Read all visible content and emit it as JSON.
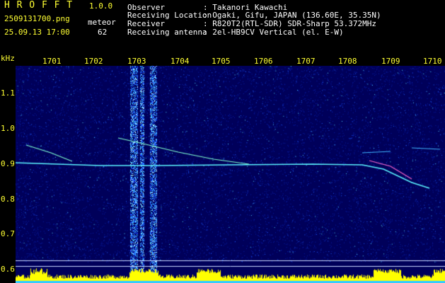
{
  "header": {
    "app_name": "H R O F F T",
    "version": "1.0.0",
    "filename": "2509131700.png",
    "datetime": "25.09.13 17:00",
    "counter_label": "meteor",
    "counter_value": "62",
    "info": [
      {
        "label": "Observer",
        "value": ": Takanori Kawachi"
      },
      {
        "label": "Receiving Location",
        "value": ": Ogaki, Gifu, JAPAN (136.60E, 35.35N)"
      },
      {
        "label": "Receiver",
        "value": ": R820T2(RTL-SDR) SDR-Sharp 53.372MHz"
      },
      {
        "label": "Receiving antenna",
        "value": ": 2el-HB9CV Vertical (el. E-W)"
      }
    ]
  },
  "axes": {
    "y_unit": "kHz",
    "x_ticks": [
      "1701",
      "1702",
      "1703",
      "1704",
      "1705",
      "1706",
      "1707",
      "1708",
      "1709",
      "1710"
    ],
    "y_ticks": [
      "1.1",
      "1.0",
      "0.9",
      "0.8",
      "0.7",
      "0.6"
    ]
  },
  "colors": {
    "label_yellow": "#ffff33",
    "background_blue": "#00005a",
    "noise_cyan": "#33ccff",
    "level_yellow": "#ffff00"
  }
}
